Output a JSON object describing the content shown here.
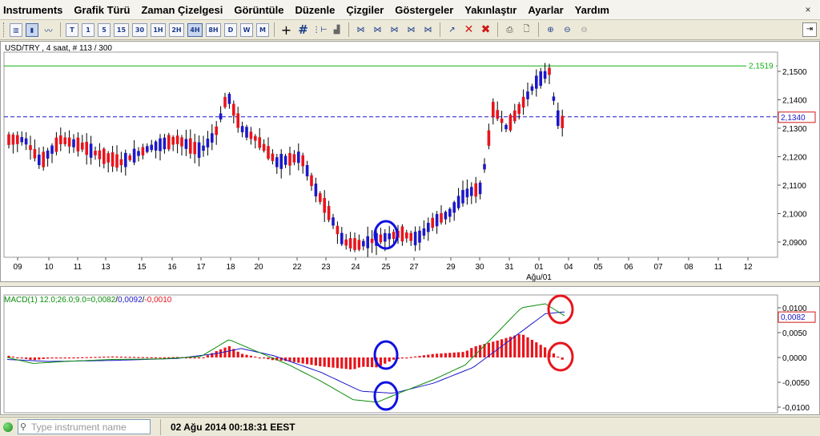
{
  "menu": [
    "Instruments",
    "Grafik Türü",
    "Zaman Çizelgesi",
    "Görüntüle",
    "Düzenle",
    "Çizgiler",
    "Göstergeler",
    "Yakınlaştır",
    "Ayarlar",
    "Yardım"
  ],
  "menu_close": "×",
  "toolbar": {
    "chart_types": [
      "bar-chart-icon",
      "candle-chart-icon",
      "line-chart-icon"
    ],
    "timeframes": [
      "T",
      "1",
      "5",
      "15",
      "30",
      "1H",
      "2H",
      "4H",
      "8H",
      "D",
      "W",
      "M"
    ],
    "active_timeframe": "4H",
    "tools": [
      "crosshair-icon",
      "grid-icon",
      "indicators-icon",
      "volume-icon",
      "trend-down-icon",
      "trend-up-icon",
      "fibonacci-icon",
      "channel-icon",
      "gann-icon",
      "cursor-delete-icon",
      "delete-icon",
      "delete-all-icon",
      "print-icon",
      "print-preview-icon",
      "zoom-in-icon",
      "zoom-out-icon",
      "zoom-reset-icon"
    ]
  },
  "chart": {
    "header": "USD/TRY , 4 saat, # 113 / 300",
    "hline_green": "2,1519",
    "hline_blue": "2,1340",
    "price_ticks": [
      "2,1500",
      "2,1400",
      "2,1300",
      "2,1200",
      "2,1100",
      "2,1000",
      "2,0900"
    ],
    "date_ticks": [
      "09",
      "10",
      "11",
      "13",
      "15",
      "16",
      "17",
      "18",
      "20",
      "22",
      "23",
      "24",
      "25",
      "27",
      "29",
      "30",
      "31",
      "01",
      "04",
      "05",
      "06",
      "07",
      "08",
      "11",
      "12"
    ],
    "month_label": "Ağu/01",
    "colors": {
      "up": "#1c18c8",
      "down": "#e8141c",
      "wick": "#000000",
      "green_line": "#12b012",
      "blue_line": "#1c18c8",
      "annotation_blue": "#1010e0",
      "annotation_red": "#e8141c"
    }
  },
  "macd": {
    "header_prefix": "MACD(1) 12.0;26.0;9.0=",
    "value_macd": "0,0082",
    "sep1": "/",
    "value_signal": "0,0092",
    "sep2": "/",
    "value_hist": "-0,0010",
    "ticks": [
      "0,0100",
      "0,0050",
      "0,0000",
      "-0,0050",
      "-0,0100"
    ],
    "current_label": "0,0082",
    "colors": {
      "macd": "#0a8c0a",
      "signal": "#1c18c8",
      "hist": "#e8141c"
    }
  },
  "status": {
    "search_placeholder": "Type instrument name",
    "datetime": "02 Ağu 2014 00:18:31 EEST"
  }
}
